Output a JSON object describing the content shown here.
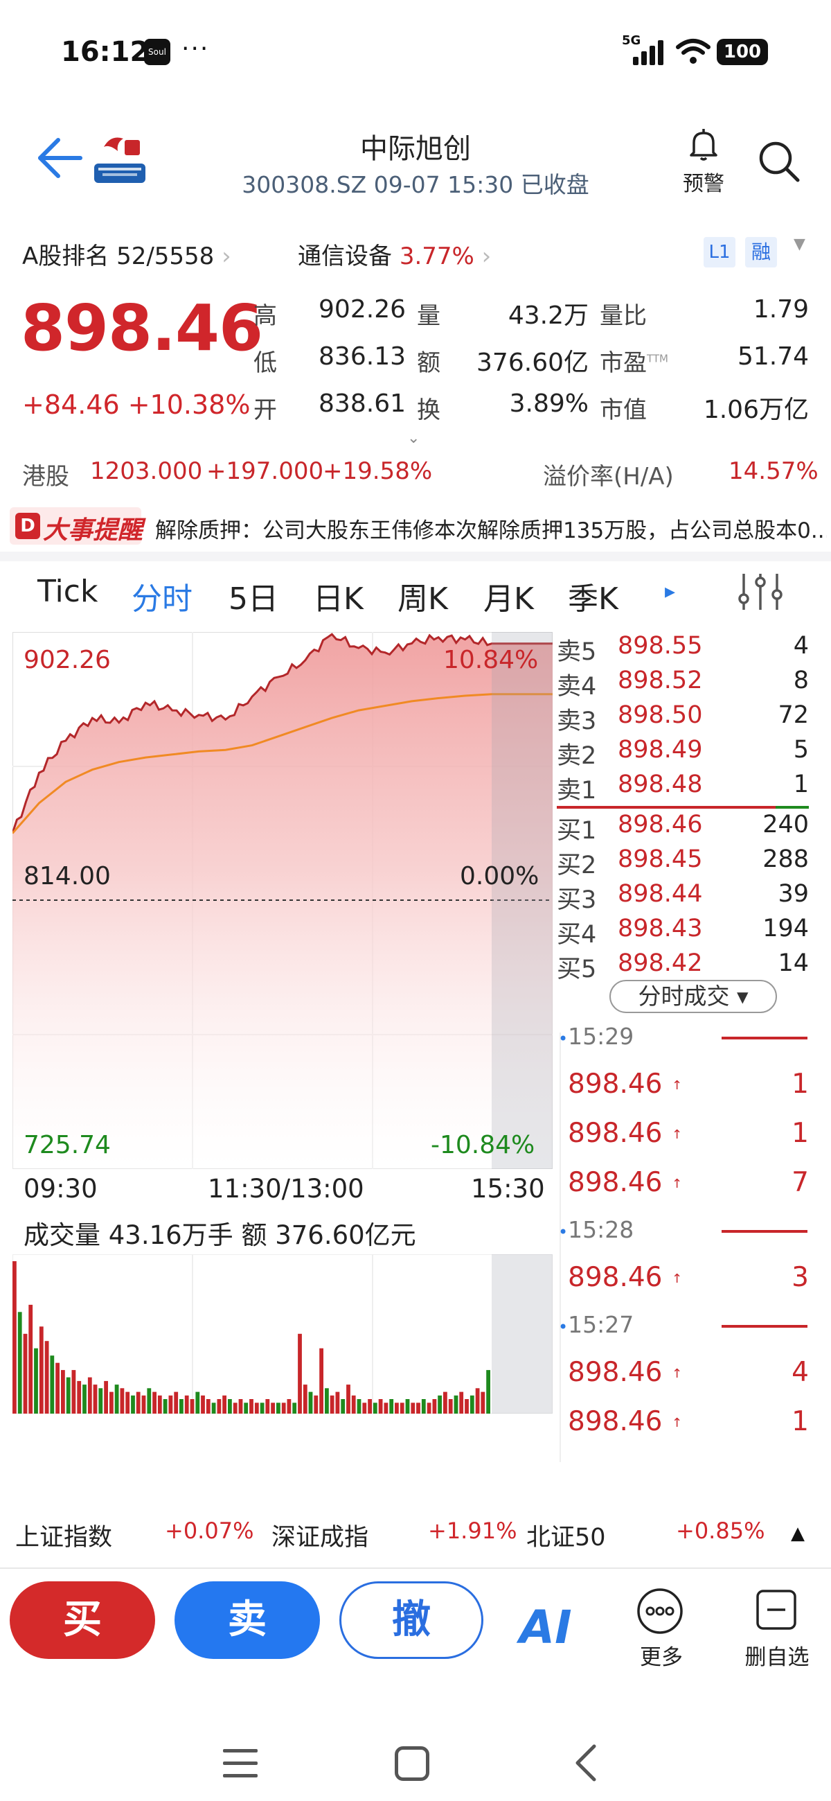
{
  "status_bar": {
    "time": "16:12",
    "soul_label": "Soul",
    "dots": "···",
    "network": "5G",
    "battery": "100"
  },
  "header": {
    "stock_name": "中际旭创",
    "stock_sub": "300308.SZ 09-07 15:30 已收盘",
    "alert_label": "预警"
  },
  "rank": {
    "a_rank": "A股排名 52/5558",
    "sector": "通信设备",
    "sector_pct": "3.77%",
    "badge_l1": "L1",
    "badge_rong": "融"
  },
  "quote": {
    "price": "898.46",
    "change": "+84.46 +10.38%",
    "stats": [
      {
        "label": "高",
        "value": "902.26",
        "color": "#c8262a"
      },
      {
        "label": "低",
        "value": "836.13",
        "color": "#c8262a"
      },
      {
        "label": "开",
        "value": "838.61",
        "color": "#c8262a"
      },
      {
        "label": "量",
        "value": "43.2万"
      },
      {
        "label": "额",
        "value": "376.60亿"
      },
      {
        "label": "换",
        "value": "3.89%"
      },
      {
        "label": "量比",
        "value": "1.79"
      },
      {
        "label": "市盈",
        "sup": "TTM",
        "value": "51.74"
      },
      {
        "label": "市值",
        "value": "1.06万亿"
      }
    ],
    "expand_icon": "⌄"
  },
  "hk": {
    "label": "港股",
    "price": "1203.000",
    "change": "+197.000",
    "pct": "+19.58%",
    "premium_label": "溢价率(H/A)",
    "premium": "14.57%"
  },
  "news": {
    "icon": "D",
    "tag": "大事提醒",
    "text": "解除质押：公司大股东王伟修本次解除质押135万股，占公司总股本0..."
  },
  "tabs": [
    "Tick",
    "分时",
    "5日",
    "日K",
    "周K",
    "月K",
    "季K"
  ],
  "active_tab": 1,
  "tab_more": "▸",
  "chart": {
    "high_label": "902.26",
    "high_pct": "10.84%",
    "mid_label": "814.00",
    "mid_pct": "0.00%",
    "low_label": "725.74",
    "low_pct": "-10.84%",
    "times": [
      "09:30",
      "11:30/13:00",
      "15:30"
    ],
    "volume_title": "成交量 43.16万手 额 376.60亿元"
  },
  "chart_data": {
    "type": "line",
    "title": "",
    "ylim": [
      725.74,
      902.26
    ],
    "x": [
      "09:30",
      "09:45",
      "10:00",
      "10:15",
      "10:30",
      "10:45",
      "11:00",
      "11:15",
      "11:30",
      "13:15",
      "13:30",
      "13:45",
      "14:00",
      "14:15",
      "14:30",
      "14:45",
      "15:00",
      "15:15",
      "15:30"
    ],
    "series": [
      {
        "name": "",
        "values": [
          836.1,
          856.0,
          866.5,
          874.0,
          872.5,
          879.0,
          876.5,
          875.0,
          873.5,
          881.0,
          887.5,
          893.0,
          901.5,
          897.0,
          895.5,
          898.5,
          900.5,
          899.8,
          898.46
        ]
      },
      {
        "name": "",
        "values": [
          836.1,
          846.0,
          853.0,
          857.0,
          859.5,
          861.0,
          862.0,
          863.0,
          863.5,
          865.0,
          868.0,
          871.0,
          874.0,
          876.5,
          878.0,
          879.5,
          880.5,
          881.3,
          881.8
        ]
      }
    ],
    "volume": [
      42,
      28,
      22,
      30,
      18,
      24,
      20,
      16,
      14,
      12,
      10,
      12,
      9,
      8,
      10,
      8,
      7,
      9,
      6,
      8,
      7,
      6,
      5,
      6,
      5,
      7,
      6,
      5,
      4,
      5,
      6,
      4,
      5,
      4,
      6,
      5,
      4,
      3,
      4,
      5,
      4,
      3,
      4,
      3,
      4,
      3,
      3,
      4,
      3,
      3,
      3,
      4,
      3,
      22,
      8,
      6,
      5,
      18,
      7,
      5,
      6,
      4,
      8,
      5,
      4,
      3,
      4,
      3,
      4,
      3,
      4,
      3,
      3,
      4,
      3,
      3,
      4,
      3,
      4,
      5,
      6,
      4,
      5,
      6,
      4,
      5,
      7,
      6,
      12
    ]
  },
  "orderbook": {
    "asks": [
      {
        "label": "卖5",
        "price": "898.55",
        "qty": "4"
      },
      {
        "label": "卖4",
        "price": "898.52",
        "qty": "8"
      },
      {
        "label": "卖3",
        "price": "898.50",
        "qty": "72"
      },
      {
        "label": "卖2",
        "price": "898.49",
        "qty": "5"
      },
      {
        "label": "卖1",
        "price": "898.48",
        "qty": "1"
      }
    ],
    "bids": [
      {
        "label": "买1",
        "price": "898.46",
        "qty": "240"
      },
      {
        "label": "买2",
        "price": "898.45",
        "qty": "288"
      },
      {
        "label": "买3",
        "price": "898.44",
        "qty": "39"
      },
      {
        "label": "买4",
        "price": "898.43",
        "qty": "194"
      },
      {
        "label": "买5",
        "price": "898.42",
        "qty": "14"
      }
    ],
    "select_label": "分时成交 ▾"
  },
  "ticks": [
    {
      "time": "15:29",
      "rows": [
        {
          "price": "898.46",
          "qty": "1"
        },
        {
          "price": "898.46",
          "qty": "1"
        },
        {
          "price": "898.46",
          "qty": "7"
        }
      ]
    },
    {
      "time": "15:28",
      "rows": [
        {
          "price": "898.46",
          "qty": "3"
        }
      ]
    },
    {
      "time": "15:27",
      "rows": [
        {
          "price": "898.46",
          "qty": "4"
        },
        {
          "price": "898.46",
          "qty": "1"
        }
      ]
    }
  ],
  "indices": [
    {
      "name": "上证指数",
      "pct": "+0.07%"
    },
    {
      "name": "深证成指",
      "pct": "+1.91%"
    },
    {
      "name": "北证50",
      "pct": "+0.85%"
    }
  ],
  "actions": {
    "buy": "买",
    "sell": "卖",
    "cancel": "撤",
    "ai": "AI",
    "more": "更多",
    "unfav": "删自选"
  },
  "colors": {
    "up": "#c8262a",
    "down": "#1e8a1e",
    "accent": "#2a7ae4",
    "avg_line": "#f08a24"
  }
}
